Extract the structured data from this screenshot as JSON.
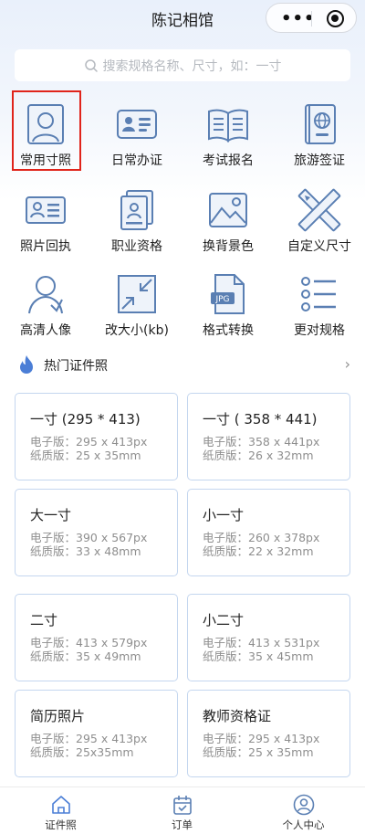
{
  "navbar": {
    "title": "陈记相馆",
    "more_glyph": "•••",
    "target_icon": "target-icon"
  },
  "search": {
    "placeholder": "搜索规格名称、尺寸，如：一寸",
    "icon": "search-icon"
  },
  "features": [
    {
      "label": "常用寸照",
      "icon": "portrait-frame-icon",
      "selected": true
    },
    {
      "label": "日常办证",
      "icon": "id-card-icon"
    },
    {
      "label": "考试报名",
      "icon": "open-book-icon"
    },
    {
      "label": "旅游签证",
      "icon": "passport-icon"
    },
    {
      "label": "照片回执",
      "icon": "receipt-card-icon"
    },
    {
      "label": "职业资格",
      "icon": "certificate-stack-icon"
    },
    {
      "label": "换背景色",
      "icon": "image-icon"
    },
    {
      "label": "自定义尺寸",
      "icon": "ruler-pencil-icon"
    },
    {
      "label": "高清人像",
      "icon": "person-icon"
    },
    {
      "label": "改大小(kb)",
      "icon": "resize-arrows-icon"
    },
    {
      "label": "格式转换",
      "icon": "jpg-file-icon",
      "badge": "JPG"
    },
    {
      "label": "更对规格",
      "icon": "list-icon"
    }
  ],
  "hot": {
    "title": "热门证件照",
    "chevron": "›",
    "cards": [
      {
        "name": "一寸 (295 * 413)",
        "electronic": "电子版：295 x 413px",
        "paper": "纸质版：25 x 35mm"
      },
      {
        "name": "一寸 ( 358 * 441)",
        "electronic": "电子版：358 x 441px",
        "paper": "纸质版：26 x 32mm"
      },
      {
        "name": "大一寸",
        "electronic": "电子版：390 x 567px",
        "paper": "纸质版：33 x 48mm"
      },
      {
        "name": "小一寸",
        "electronic": "电子版：260 x 378px",
        "paper": "纸质版：22 x 32mm"
      },
      {
        "name": "二寸",
        "electronic": "电子版：413 x 579px",
        "paper": "纸质版：35 x 49mm"
      },
      {
        "name": "小二寸",
        "electronic": "电子版：413 x 531px",
        "paper": "纸质版：35 x 45mm"
      },
      {
        "name": "简历照片",
        "electronic": "电子版：295 x 413px",
        "paper": "纸质版：25x35mm"
      },
      {
        "name": "教师资格证",
        "electronic": "电子版：295 x 413px",
        "paper": "纸质版：25 x 35mm"
      }
    ]
  },
  "tabbar": [
    {
      "label": "证件照",
      "icon": "home-icon",
      "active": true
    },
    {
      "label": "订单",
      "icon": "calendar-check-icon"
    },
    {
      "label": "个人中心",
      "icon": "user-circle-icon"
    }
  ],
  "colors": {
    "icon_blue": "#5a7fb3",
    "selected_border": "#e0241b",
    "card_border": "#c4d6ef",
    "flame": "#4b7ed6"
  }
}
